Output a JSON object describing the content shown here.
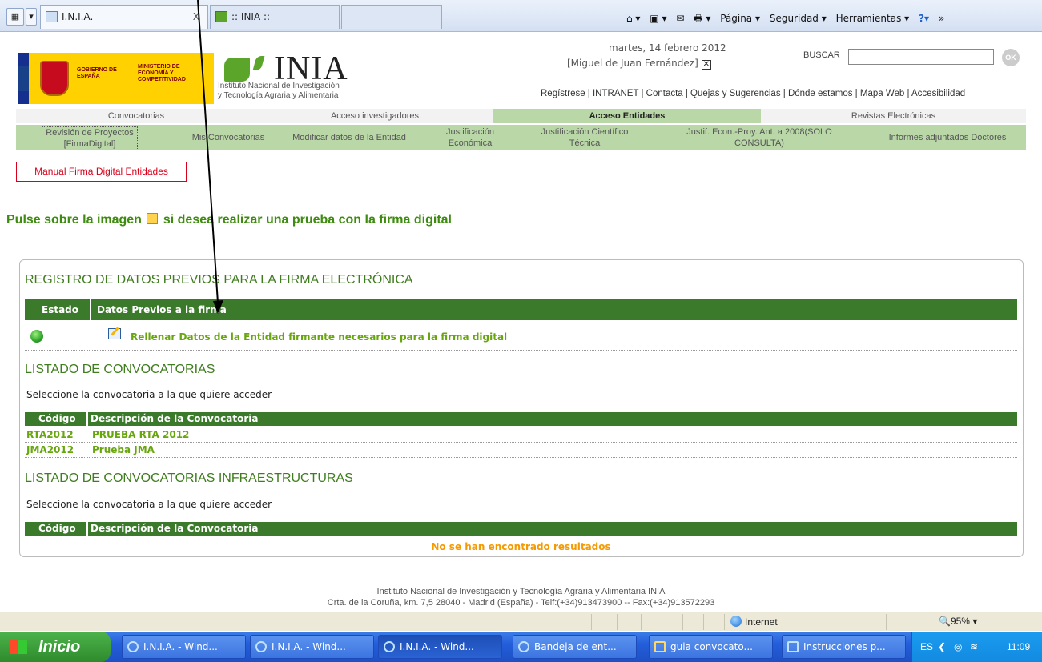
{
  "browser": {
    "tab1_title": "I.N.I.A.",
    "tab1_close": "X",
    "tab2_title": ":: INIA ::",
    "tools": [
      "Página ▾",
      "Seguridad ▾",
      "Herramientas ▾"
    ]
  },
  "header": {
    "gob_left": "GOBIERNO DE ESPAÑA",
    "gob_right": "MINISTERIO DE ECONOMÍA Y COMPETITIVIDAD",
    "inia_word": "INIA",
    "inia_sub_1": "Instituto Nacional de Investigación",
    "inia_sub_2": "y Tecnología Agraria y Alimentaria",
    "date": "martes, 14 febrero 2012",
    "user": "[Miguel de Juan Fernández]",
    "search_label": "BUSCAR",
    "search_value": "",
    "ok": "OK",
    "links": "Regístrese | INTRANET | Contacta | Quejas y Sugerencias | Dónde estamos | Mapa Web | Accesibilidad"
  },
  "nav": {
    "main": [
      "Convocatorias",
      "Acceso investigadores",
      "Acceso Entidades",
      "Revistas Electrónicas"
    ],
    "sub": [
      "Revisión de Proyectos [FirmaDigital]",
      "Mis Convocatorias",
      "Modificar datos de la Entidad",
      "Justificación Económica",
      "Justificación Científico Técnica",
      "Justif. Econ.-Proy. Ant. a 2008(SOLO CONSULTA)",
      "Informes adjuntados Doctores"
    ]
  },
  "main": {
    "manual_button": "Manual Firma Digital Entidades",
    "pulse_1": "Pulse sobre la imagen",
    "pulse_2": "si desea realizar una prueba con la firma digital",
    "registro": {
      "title": "REGISTRO DE DATOS PREVIOS PARA LA FIRMA ELECTRÓNICA",
      "col1": "Estado",
      "col2": "Datos Previos a la firma",
      "row_link": "Rellenar Datos de la Entidad firmante necesarios para la firma digital"
    },
    "listado": {
      "title": "LISTADO DE CONVOCATORIAS",
      "instr": "Seleccione la convocatoria a la que quiere acceder",
      "col1": "Código",
      "col2": "Descripción de la Convocatoria",
      "rows": [
        {
          "code": "RTA2012",
          "desc": "PRUEBA RTA 2012"
        },
        {
          "code": "JMA2012",
          "desc": "Prueba JMA"
        }
      ]
    },
    "infra": {
      "title": "LISTADO DE CONVOCATORIAS INFRAESTRUCTURAS",
      "instr": "Seleccione la convocatoria a la que quiere acceder",
      "col1": "Código",
      "col2": "Descripción de la Convocatoria",
      "empty": "No se han encontrado resultados"
    }
  },
  "footer": {
    "line1": "Instituto Nacional de Investigación y Tecnología Agraria y Alimentaria INIA",
    "line2": "Crta. de la Coruña, km. 7,5 28040 - Madrid (España) - Telf:(+34)913473900 -- Fax:(+34)913572293"
  },
  "statusbar": {
    "zone": "Internet",
    "zoom": "95%"
  },
  "taskbar": {
    "start": "Inicio",
    "tasks": [
      "I.N.I.A. - Wind...",
      "I.N.I.A. - Wind...",
      "I.N.I.A. - Wind...",
      "Bandeja de ent...",
      "guia convocato...",
      "Instrucciones p..."
    ],
    "lang": "ES",
    "clock": "11:09"
  }
}
